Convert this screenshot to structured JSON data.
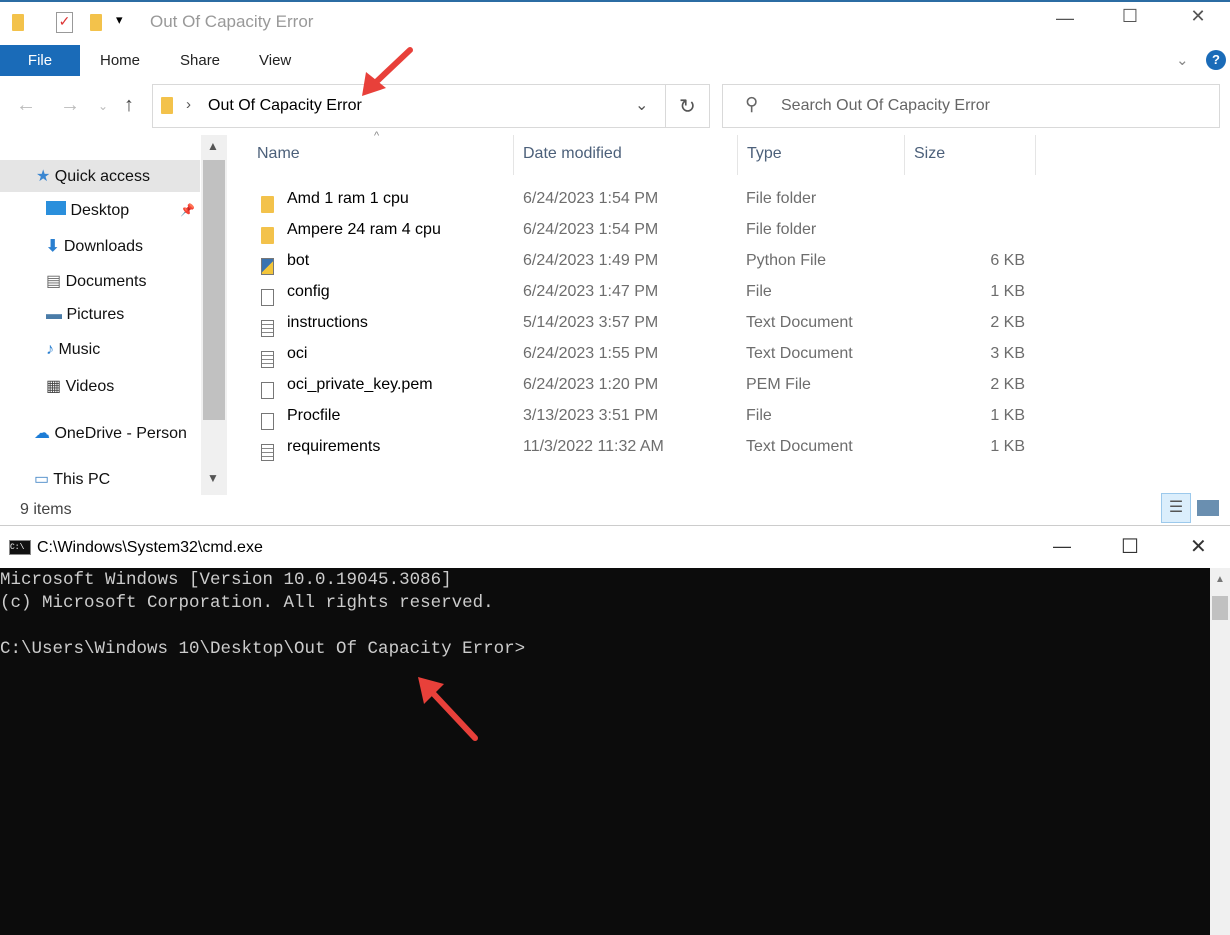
{
  "explorer": {
    "title": "Out Of Capacity Error",
    "ribbon_tabs": [
      "File",
      "Home",
      "Share",
      "View"
    ],
    "address": "Out Of Capacity Error",
    "search_placeholder": "Search Out Of Capacity Error",
    "nav": [
      {
        "label": "Quick access",
        "icon": "star-icon"
      },
      {
        "label": "Desktop",
        "icon": "desktop-icon"
      },
      {
        "label": "Downloads",
        "icon": "download-icon"
      },
      {
        "label": "Documents",
        "icon": "documents-icon"
      },
      {
        "label": "Pictures",
        "icon": "pictures-icon"
      },
      {
        "label": "Music",
        "icon": "music-icon"
      },
      {
        "label": "Videos",
        "icon": "videos-icon"
      },
      {
        "label": "OneDrive - Person",
        "icon": "cloud-icon"
      },
      {
        "label": "This PC",
        "icon": "computer-icon"
      }
    ],
    "columns": [
      "Name",
      "Date modified",
      "Type",
      "Size"
    ],
    "files": [
      {
        "name": "Amd 1 ram 1 cpu",
        "date": "6/24/2023 1:54 PM",
        "type": "File folder",
        "size": "",
        "icon": "folder"
      },
      {
        "name": "Ampere 24 ram 4 cpu",
        "date": "6/24/2023 1:54 PM",
        "type": "File folder",
        "size": "",
        "icon": "folder"
      },
      {
        "name": "bot",
        "date": "6/24/2023 1:49 PM",
        "type": "Python File",
        "size": "6 KB",
        "icon": "python"
      },
      {
        "name": "config",
        "date": "6/24/2023 1:47 PM",
        "type": "File",
        "size": "1 KB",
        "icon": "file"
      },
      {
        "name": "instructions",
        "date": "5/14/2023 3:57 PM",
        "type": "Text Document",
        "size": "2 KB",
        "icon": "text"
      },
      {
        "name": "oci",
        "date": "6/24/2023 1:55 PM",
        "type": "Text Document",
        "size": "3 KB",
        "icon": "text"
      },
      {
        "name": "oci_private_key.pem",
        "date": "6/24/2023 1:20 PM",
        "type": "PEM File",
        "size": "2 KB",
        "icon": "file"
      },
      {
        "name": "Procfile",
        "date": "3/13/2023 3:51 PM",
        "type": "File",
        "size": "1 KB",
        "icon": "file"
      },
      {
        "name": "requirements",
        "date": "11/3/2022 11:32 AM",
        "type": "Text Document",
        "size": "1 KB",
        "icon": "text"
      }
    ],
    "status": "9 items"
  },
  "cmd": {
    "title": "C:\\Windows\\System32\\cmd.exe",
    "lines": [
      "Microsoft Windows [Version 10.0.19045.3086]",
      "(c) Microsoft Corporation. All rights reserved.",
      "",
      "C:\\Users\\Windows 10\\Desktop\\Out Of Capacity Error>"
    ]
  },
  "colors": {
    "accent": "#1a6bb8",
    "arrow": "#e8403a",
    "console_bg": "#0c0c0c"
  }
}
